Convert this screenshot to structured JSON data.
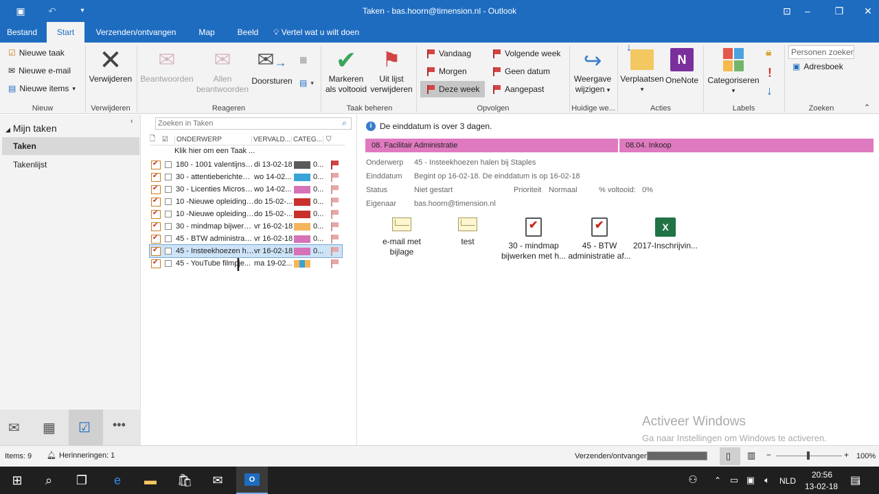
{
  "window": {
    "title": "Taken - bas.hoorn@timension.nl  -  Outlook"
  },
  "tabs": [
    {
      "label": "Bestand"
    },
    {
      "label": "Start"
    },
    {
      "label": "Verzenden/ontvangen"
    },
    {
      "label": "Map"
    },
    {
      "label": "Beeld"
    }
  ],
  "tellme": "Vertel wat u wilt doen",
  "ribbon": {
    "nieuw": {
      "new_task": "Nieuwe taak",
      "new_email": "Nieuwe e-mail",
      "new_items": "Nieuwe items",
      "label": "Nieuw"
    },
    "verwijderen": {
      "delete": "Verwijderen",
      "label": "Verwijderen"
    },
    "reageren": {
      "reply": "Beantwoorden",
      "reply_all_1": "Allen",
      "reply_all_2": "beantwoorden",
      "forward": "Doorsturen",
      "label": "Reageren"
    },
    "taak": {
      "mark_1": "Markeren",
      "mark_2": "als voltooid",
      "remove_1": "Uit lijst",
      "remove_2": "verwijderen",
      "label": "Taak beheren"
    },
    "opvolgen": {
      "today": "Vandaag",
      "tomorrow": "Morgen",
      "this_week": "Deze week",
      "next_week": "Volgende week",
      "no_date": "Geen datum",
      "custom": "Aangepast",
      "label": "Opvolgen"
    },
    "huidige": {
      "view_1": "Weergave",
      "view_2": "wijzigen",
      "label": "Huidige we..."
    },
    "acties": {
      "move": "Verplaatsen",
      "onenote": "OneNote",
      "label": "Acties"
    },
    "labels": {
      "categorize": "Categoriseren",
      "label": "Labels"
    },
    "zoeken": {
      "people": "Personen zoeken",
      "addressbook": "Adresboek",
      "label": "Zoeken"
    }
  },
  "leftnav": {
    "header": "Mijn taken",
    "items": [
      {
        "label": "Taken"
      },
      {
        "label": "Takenlijst"
      }
    ]
  },
  "tasklist": {
    "search_placeholder": "Zoeken in Taken",
    "headers": {
      "subject": "ONDERWERP",
      "due": "VERVALD...",
      "cat": "CATEG..."
    },
    "new_task_row": "Klik hier om een Taak ...",
    "rows": [
      {
        "subject": "180 - 1001 valentijnska...",
        "due": "di 13-02-18",
        "cat_colors": [
          "#5a5a5a",
          "#5a5a5a"
        ],
        "cat": "0...",
        "flag": "dark"
      },
      {
        "subject": "30 - attentieberichten ...",
        "due": "wo 14-02...",
        "cat_colors": [
          "#38a3d6",
          "#38a3d6"
        ],
        "cat": "0...",
        "flag": "light"
      },
      {
        "subject": "30 - Licenties Microsof...",
        "due": "wo 14-02...",
        "cat_colors": [
          "#d672b8",
          "#d672b8"
        ],
        "cat": "0...",
        "flag": "light"
      },
      {
        "subject": "10 -Nieuwe opleidings...",
        "due": "do 15-02-...",
        "cat_colors": [
          "#c8302c",
          "#c8302c"
        ],
        "cat": "0...",
        "flag": "light"
      },
      {
        "subject": "10 -Nieuwe opleidings...",
        "due": "do 15-02-...",
        "cat_colors": [
          "#c8302c",
          "#c8302c"
        ],
        "cat": "0...",
        "flag": "light"
      },
      {
        "subject": "30 - mindmap bijwerke...",
        "due": "vr 16-02-18",
        "cat_colors": [
          "#f5b55a",
          "#f5b55a"
        ],
        "cat": "0...",
        "flag": "light"
      },
      {
        "subject": "45 - BTW administratie...",
        "due": "vr 16-02-18",
        "cat_colors": [
          "#d672b8",
          "#d672b8"
        ],
        "cat": "0...",
        "flag": "light"
      },
      {
        "subject": "45 - Insteekhoezen hal...",
        "due": "vr 16-02-18",
        "cat_colors": [
          "#d672b8",
          "#d672b8"
        ],
        "cat": "0...",
        "flag": "light",
        "selected": true
      },
      {
        "subject": "45 - YouTube filmpje...",
        "due": "ma 19-02...",
        "cat_colors": [
          "#f5b55a",
          "#38a3d6",
          "#f5b55a"
        ],
        "cat": "",
        "flag": "light"
      }
    ]
  },
  "reading": {
    "info": "De einddatum is over 3 dagen.",
    "categories": [
      "08. Facilitair Administratie",
      "08.04. Inkoop"
    ],
    "fields": {
      "subject_label": "Onderwerp",
      "subject": "45 - Insteekhoezen halen bij Staples",
      "due_label": "Einddatum",
      "due": "Begint op 16-02-18. De einddatum is op 16-02-18",
      "status_label": "Status",
      "status": "Niet gestart",
      "priority_label": "Prioriteit",
      "priority": "Normaal",
      "percent_label": "% voltooid:",
      "percent": "0%",
      "owner_label": "Eigenaar",
      "owner": "bas.hoorn@timension.nl"
    },
    "attachments": [
      {
        "line1": "e-mail met",
        "line2": "bijlage",
        "icon": "envelope-icon"
      },
      {
        "line1": "test",
        "line2": "",
        "icon": "envelope-icon"
      },
      {
        "line1": "30 - mindmap",
        "line2": "bijwerken met h...",
        "icon": "task-icon"
      },
      {
        "line1": "45 - BTW",
        "line2": "administratie af...",
        "icon": "task-icon"
      },
      {
        "line1": "2017-Inschrijvin...",
        "line2": "",
        "icon": "excel-icon"
      }
    ],
    "watermark1": "Activeer Windows",
    "watermark2": "Ga naar Instellingen om Windows te activeren."
  },
  "status": {
    "items": "Items: 9",
    "reminders": "Herinneringen: 1",
    "sendrecv": "Verzenden/ontvangen",
    "zoom": "100%"
  },
  "taskbar": {
    "lang": "NLD",
    "time": "20:56",
    "date": "13-02-18",
    "notif": "4"
  }
}
